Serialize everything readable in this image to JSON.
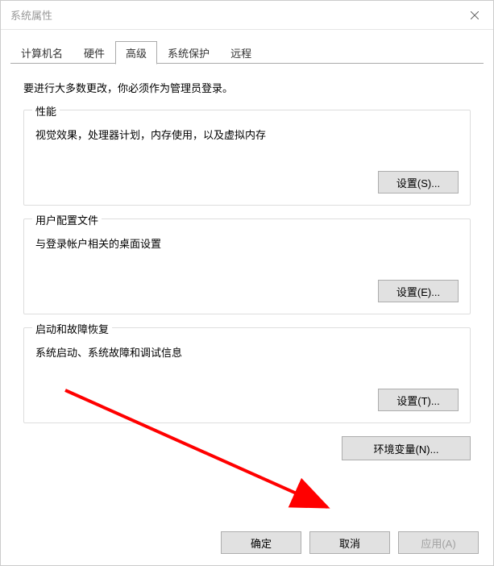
{
  "window": {
    "title": "系统属性"
  },
  "tabs": {
    "computer_name": "计算机名",
    "hardware": "硬件",
    "advanced": "高级",
    "system_protection": "系统保护",
    "remote": "远程"
  },
  "content": {
    "intro": "要进行大多数更改，你必须作为管理员登录。",
    "performance": {
      "title": "性能",
      "desc": "视觉效果，处理器计划，内存使用，以及虚拟内存",
      "button": "设置(S)..."
    },
    "user_profiles": {
      "title": "用户配置文件",
      "desc": "与登录帐户相关的桌面设置",
      "button": "设置(E)..."
    },
    "startup_recovery": {
      "title": "启动和故障恢复",
      "desc": "系统启动、系统故障和调试信息",
      "button": "设置(T)..."
    },
    "env_vars_button": "环境变量(N)..."
  },
  "buttons": {
    "ok": "确定",
    "cancel": "取消",
    "apply": "应用(A)"
  }
}
